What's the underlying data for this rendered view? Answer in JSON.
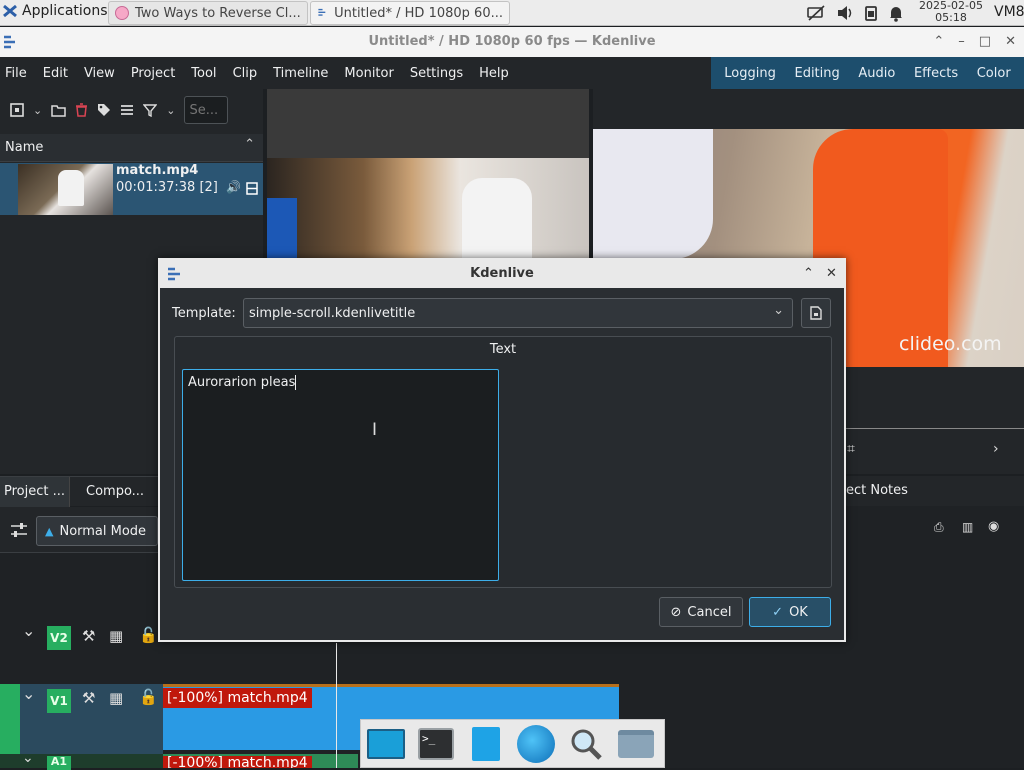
{
  "top_panel": {
    "applications_label": "Applications",
    "tasks": [
      {
        "label": "Two Ways to Reverse Cl..."
      },
      {
        "label": "Untitled* / HD 1080p 60..."
      }
    ],
    "date": "2025-02-05",
    "time": "05:18",
    "user": "VM8"
  },
  "window": {
    "title": "Untitled* / HD 1080p 60 fps — Kdenlive"
  },
  "menu": [
    "File",
    "Edit",
    "View",
    "Project",
    "Tool",
    "Clip",
    "Timeline",
    "Monitor",
    "Settings",
    "Help"
  ],
  "layouts": [
    "Logging",
    "Editing",
    "Audio",
    "Effects",
    "Color"
  ],
  "bin": {
    "search_placeholder": "Se...",
    "column_name": "Name",
    "clip": {
      "name": "match.mp4",
      "duration": "00:01:37:38 [2]"
    }
  },
  "monitor": {
    "watermark": "clideo.com"
  },
  "lower_tabs": {
    "project": "Project ...",
    "compositions": "Compo...",
    "notes": "ect Notes"
  },
  "timeline": {
    "mode": "Normal Mode",
    "tracks": [
      {
        "tag": "V2"
      },
      {
        "tag": "V1",
        "clip": "[-100%] match.mp4"
      },
      {
        "tag": "A1",
        "clip": "[-100%] match.mp4"
      }
    ]
  },
  "dialog": {
    "title": "Kdenlive",
    "template_label": "Template:",
    "template_value": "simple-scroll.kdenlivetitle",
    "group_label": "Text",
    "text_value": "Aurorarion pleas",
    "cancel": "Cancel",
    "ok": "OK"
  },
  "colors": {
    "accent": "#3daee9",
    "layout_bar": "#1d4e6d",
    "track_tag": "#27ae60",
    "clip_blue": "#2a9ae4",
    "clip_label": "#c0180c"
  }
}
